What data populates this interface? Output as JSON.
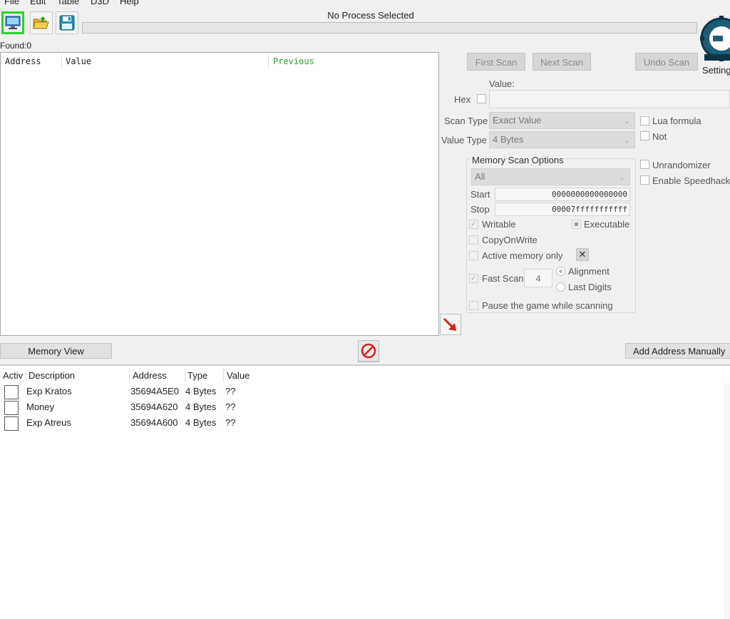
{
  "menu": [
    "File",
    "Edit",
    "Table",
    "D3D",
    "Help"
  ],
  "process_title": "No Process Selected",
  "found_label": "Found:0",
  "settings_label": "Settings",
  "logo_text": "Cheat Engine",
  "results": {
    "columns": [
      "Address",
      "Value",
      "Previous"
    ],
    "previous_color": "#2a9d2a"
  },
  "scan": {
    "first_scan": "First Scan",
    "next_scan": "Next Scan",
    "undo_scan": "Undo Scan",
    "value_label": "Value:",
    "hex_label": "Hex",
    "scan_type_label": "Scan Type",
    "scan_type_value": "Exact Value",
    "value_type_label": "Value Type",
    "value_type_value": "4 Bytes",
    "lua_formula": "Lua formula",
    "not": "Not",
    "unrandomizer": "Unrandomizer",
    "enable_speedhack": "Enable Speedhack"
  },
  "memory_scan_options": {
    "title": "Memory Scan Options",
    "region": "All",
    "start_label": "Start",
    "start_value": "0000000000000000",
    "stop_label": "Stop",
    "stop_value": "00007fffffffffff",
    "writable": "Writable",
    "executable": "Executable",
    "copy_on_write": "CopyOnWrite",
    "active_memory_only": "Active memory only",
    "fast_scan": "Fast Scan",
    "fast_scan_value": "4",
    "alignment": "Alignment",
    "last_digits": "Last Digits",
    "pause_game": "Pause the game while scanning"
  },
  "memory_view_button": "Memory View",
  "add_address_button": "Add Address Manually",
  "address_table": {
    "columns": [
      "Activ",
      "Description",
      "Address",
      "Type",
      "Value"
    ],
    "rows": [
      {
        "description": "Exp Kratos",
        "address": "35694A5E0",
        "type": "4 Bytes",
        "value": "??"
      },
      {
        "description": "Money",
        "address": "35694A620",
        "type": "4 Bytes",
        "value": "??"
      },
      {
        "description": "Exp Atreus",
        "address": "35694A600",
        "type": "4 Bytes",
        "value": "??"
      }
    ]
  },
  "colors": {
    "highlight": "#2bd12b",
    "background": "#f0f0f0",
    "disabled_text": "#888888"
  },
  "icons": [
    "computer-icon",
    "open-folder-icon",
    "save-disk-icon",
    "cheat-engine-logo",
    "red-arrow-icon",
    "stop-icon",
    "close-x-icon"
  ]
}
